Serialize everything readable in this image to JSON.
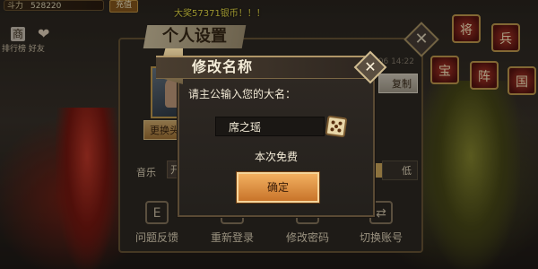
{
  "topbar": {
    "power_label": "斗力",
    "power_value": "528220",
    "recharge_label": "充值",
    "marquee": "大奖57371银币！！！"
  },
  "left_panel": {
    "ranking_label": "排行榜",
    "friends_label": "好友"
  },
  "settings": {
    "title": "个人设置",
    "date_text": "2018.06 14:22",
    "change_label": "更换头",
    "copy_label": "复制",
    "music_label": "音乐",
    "music_on_label": "开",
    "low_label": "低",
    "actions": [
      {
        "label": "问题反馈",
        "icon": "E"
      },
      {
        "label": "重新登录",
        "icon": "↻"
      },
      {
        "label": "修改密码",
        "icon": "✎"
      },
      {
        "label": "切换账号",
        "icon": "⇄"
      }
    ]
  },
  "modal": {
    "title": "修改名称",
    "prompt": "请主公输入您的大名：",
    "name_value": "席之瑶",
    "free_text": "本次免费",
    "confirm_label": "确定"
  },
  "right_icons": [
    "将",
    "兵",
    "宝",
    "阵",
    "国"
  ]
}
